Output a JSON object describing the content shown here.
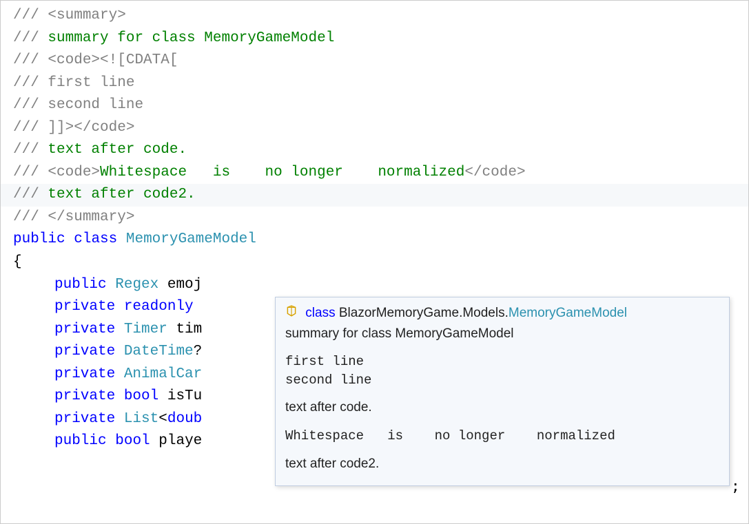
{
  "code": {
    "lines": [
      {
        "segs": [
          {
            "t": "/// ",
            "c": "gray"
          },
          {
            "t": "<summary>",
            "c": "gray"
          }
        ]
      },
      {
        "segs": [
          {
            "t": "/// ",
            "c": "gray"
          },
          {
            "t": "summary for class MemoryGameModel",
            "c": "green"
          }
        ]
      },
      {
        "segs": [
          {
            "t": "/// ",
            "c": "gray"
          },
          {
            "t": "<code>",
            "c": "gray"
          },
          {
            "t": "<![CDATA[",
            "c": "gray"
          }
        ]
      },
      {
        "segs": [
          {
            "t": "/// ",
            "c": "gray"
          },
          {
            "t": "first line",
            "c": "gray"
          }
        ]
      },
      {
        "segs": [
          {
            "t": "/// ",
            "c": "gray"
          },
          {
            "t": "second line",
            "c": "gray"
          }
        ]
      },
      {
        "segs": [
          {
            "t": "/// ",
            "c": "gray"
          },
          {
            "t": "]]>",
            "c": "gray"
          },
          {
            "t": "</code>",
            "c": "gray"
          }
        ]
      },
      {
        "segs": [
          {
            "t": "/// ",
            "c": "gray"
          },
          {
            "t": "text after code.",
            "c": "green"
          }
        ]
      },
      {
        "segs": [
          {
            "t": "/// ",
            "c": "gray"
          },
          {
            "t": "<code>",
            "c": "gray"
          },
          {
            "t": "Whitespace   is    no longer    normalized",
            "c": "green"
          },
          {
            "t": "</code>",
            "c": "gray"
          }
        ]
      },
      {
        "segs": [
          {
            "t": "/// ",
            "c": "gray"
          },
          {
            "t": "text after code2.",
            "c": "green"
          }
        ],
        "hl": true
      },
      {
        "segs": [
          {
            "t": "/// ",
            "c": "gray"
          },
          {
            "t": "</summary>",
            "c": "gray"
          }
        ]
      },
      {
        "segs": [
          {
            "t": "public",
            "c": "blue"
          },
          {
            "t": " ",
            "c": "black"
          },
          {
            "t": "class",
            "c": "blue"
          },
          {
            "t": " ",
            "c": "black"
          },
          {
            "t": "MemoryGameModel",
            "c": "teal"
          }
        ]
      },
      {
        "segs": [
          {
            "t": "{",
            "c": "brace"
          }
        ]
      },
      {
        "indent": true,
        "segs": [
          {
            "t": "public",
            "c": "blue"
          },
          {
            "t": " ",
            "c": "black"
          },
          {
            "t": "Regex",
            "c": "teal"
          },
          {
            "t": " emoj",
            "c": "black"
          }
        ]
      },
      {
        "indent": true,
        "segs": [
          {
            "t": "private",
            "c": "blue"
          },
          {
            "t": " ",
            "c": "black"
          },
          {
            "t": "readonly",
            "c": "blue"
          },
          {
            "t": " ",
            "c": "black"
          }
        ]
      },
      {
        "indent": true,
        "segs": [
          {
            "t": "private",
            "c": "blue"
          },
          {
            "t": " ",
            "c": "black"
          },
          {
            "t": "Timer",
            "c": "teal"
          },
          {
            "t": " tim",
            "c": "black"
          }
        ]
      },
      {
        "indent": true,
        "segs": [
          {
            "t": "private",
            "c": "blue"
          },
          {
            "t": " ",
            "c": "black"
          },
          {
            "t": "DateTime",
            "c": "teal"
          },
          {
            "t": "?",
            "c": "black"
          }
        ]
      },
      {
        "indent": true,
        "segs": [
          {
            "t": "private",
            "c": "blue"
          },
          {
            "t": " ",
            "c": "black"
          },
          {
            "t": "AnimalCar",
            "c": "teal"
          }
        ]
      },
      {
        "indent": true,
        "segs": [
          {
            "t": "private",
            "c": "blue"
          },
          {
            "t": " ",
            "c": "black"
          },
          {
            "t": "bool",
            "c": "blue"
          },
          {
            "t": " isTu",
            "c": "black"
          }
        ]
      },
      {
        "indent": true,
        "segs": [
          {
            "t": "private",
            "c": "blue"
          },
          {
            "t": " ",
            "c": "black"
          },
          {
            "t": "List",
            "c": "teal"
          },
          {
            "t": "<",
            "c": "black"
          },
          {
            "t": "doub",
            "c": "blue"
          }
        ],
        "trail_semi": true
      },
      {
        "indent": true,
        "segs": [
          {
            "t": "public",
            "c": "blue"
          },
          {
            "t": " ",
            "c": "black"
          },
          {
            "t": "bool",
            "c": "blue"
          },
          {
            "t": " playe",
            "c": "black"
          }
        ]
      }
    ]
  },
  "tooltip": {
    "kw": "class",
    "ns": "BlazorMemoryGame.Models.",
    "type": "MemoryGameModel",
    "summary": "summary for class MemoryGameModel",
    "code1": "first line\nsecond line",
    "text1": "text after code.",
    "code2": "Whitespace   is    no longer    normalized",
    "text2": "text after code2."
  }
}
